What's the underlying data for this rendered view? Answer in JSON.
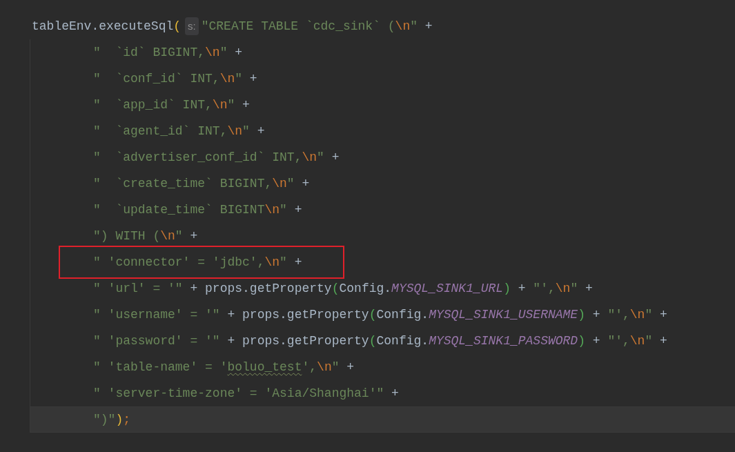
{
  "editor": {
    "lines": [
      {
        "kind": "statement",
        "current": false,
        "boxed": false,
        "tokens": [
          {
            "kind": "plain",
            "text": "tableEnv.executeSql"
          },
          {
            "kind": "bracket",
            "text": "("
          },
          {
            "kind": "hint",
            "text": "s:"
          },
          {
            "kind": "string",
            "text": "\"CREATE TABLE `cdc_sink` ("
          },
          {
            "kind": "escape",
            "text": "\\n"
          },
          {
            "kind": "string",
            "text": "\""
          },
          {
            "kind": "plain",
            "text": " +"
          }
        ]
      },
      {
        "kind": "continuation",
        "current": false,
        "boxed": false,
        "tokens": [
          {
            "kind": "string",
            "text": "\"  `id` BIGINT,"
          },
          {
            "kind": "escape",
            "text": "\\n"
          },
          {
            "kind": "string",
            "text": "\""
          },
          {
            "kind": "plain",
            "text": " +"
          }
        ]
      },
      {
        "kind": "continuation",
        "current": false,
        "boxed": false,
        "tokens": [
          {
            "kind": "string",
            "text": "\"  `conf_id` INT,"
          },
          {
            "kind": "escape",
            "text": "\\n"
          },
          {
            "kind": "string",
            "text": "\""
          },
          {
            "kind": "plain",
            "text": " +"
          }
        ]
      },
      {
        "kind": "continuation",
        "current": false,
        "boxed": false,
        "tokens": [
          {
            "kind": "string",
            "text": "\"  `app_id` INT,"
          },
          {
            "kind": "escape",
            "text": "\\n"
          },
          {
            "kind": "string",
            "text": "\""
          },
          {
            "kind": "plain",
            "text": " +"
          }
        ]
      },
      {
        "kind": "continuation",
        "current": false,
        "boxed": false,
        "tokens": [
          {
            "kind": "string",
            "text": "\"  `agent_id` INT,"
          },
          {
            "kind": "escape",
            "text": "\\n"
          },
          {
            "kind": "string",
            "text": "\""
          },
          {
            "kind": "plain",
            "text": " +"
          }
        ]
      },
      {
        "kind": "continuation",
        "current": false,
        "boxed": false,
        "tokens": [
          {
            "kind": "string",
            "text": "\"  `advertiser_conf_id` INT,"
          },
          {
            "kind": "escape",
            "text": "\\n"
          },
          {
            "kind": "string",
            "text": "\""
          },
          {
            "kind": "plain",
            "text": " +"
          }
        ]
      },
      {
        "kind": "continuation",
        "current": false,
        "boxed": false,
        "tokens": [
          {
            "kind": "string",
            "text": "\"  `create_time` BIGINT,"
          },
          {
            "kind": "escape",
            "text": "\\n"
          },
          {
            "kind": "string",
            "text": "\""
          },
          {
            "kind": "plain",
            "text": " +"
          }
        ]
      },
      {
        "kind": "continuation",
        "current": false,
        "boxed": false,
        "tokens": [
          {
            "kind": "string",
            "text": "\"  `update_time` BIGINT"
          },
          {
            "kind": "escape",
            "text": "\\n"
          },
          {
            "kind": "string",
            "text": "\""
          },
          {
            "kind": "plain",
            "text": " +"
          }
        ]
      },
      {
        "kind": "continuation",
        "current": false,
        "boxed": false,
        "tokens": [
          {
            "kind": "string",
            "text": "\") WITH ("
          },
          {
            "kind": "escape",
            "text": "\\n"
          },
          {
            "kind": "string",
            "text": "\""
          },
          {
            "kind": "plain",
            "text": " +"
          }
        ]
      },
      {
        "kind": "continuation",
        "current": false,
        "boxed": true,
        "tokens": [
          {
            "kind": "string",
            "text": "\" 'connector' = 'jdbc',"
          },
          {
            "kind": "escape",
            "text": "\\n"
          },
          {
            "kind": "string",
            "text": "\""
          },
          {
            "kind": "plain",
            "text": " +"
          }
        ]
      },
      {
        "kind": "continuation",
        "current": false,
        "boxed": false,
        "tokens": [
          {
            "kind": "string",
            "text": "\" 'url' = '\""
          },
          {
            "kind": "plain",
            "text": " + props.getProperty"
          },
          {
            "kind": "bracket2",
            "text": "("
          },
          {
            "kind": "plain",
            "text": "Config."
          },
          {
            "kind": "constant",
            "text": "MYSQL_SINK1_URL"
          },
          {
            "kind": "bracket2",
            "text": ")"
          },
          {
            "kind": "plain",
            "text": " + "
          },
          {
            "kind": "string",
            "text": "\"',"
          },
          {
            "kind": "escape",
            "text": "\\n"
          },
          {
            "kind": "string",
            "text": "\""
          },
          {
            "kind": "plain",
            "text": " +"
          }
        ]
      },
      {
        "kind": "continuation",
        "current": false,
        "boxed": false,
        "tokens": [
          {
            "kind": "string",
            "text": "\" 'username' = '\""
          },
          {
            "kind": "plain",
            "text": " + props.getProperty"
          },
          {
            "kind": "bracket2",
            "text": "("
          },
          {
            "kind": "plain",
            "text": "Config."
          },
          {
            "kind": "constant",
            "text": "MYSQL_SINK1_USERNAME"
          },
          {
            "kind": "bracket2",
            "text": ")"
          },
          {
            "kind": "plain",
            "text": " + "
          },
          {
            "kind": "string",
            "text": "\"',"
          },
          {
            "kind": "escape",
            "text": "\\n"
          },
          {
            "kind": "string",
            "text": "\""
          },
          {
            "kind": "plain",
            "text": " +"
          }
        ]
      },
      {
        "kind": "continuation",
        "current": false,
        "boxed": false,
        "tokens": [
          {
            "kind": "string",
            "text": "\" 'password' = '\""
          },
          {
            "kind": "plain",
            "text": " + props.getProperty"
          },
          {
            "kind": "bracket2",
            "text": "("
          },
          {
            "kind": "plain",
            "text": "Config."
          },
          {
            "kind": "constant",
            "text": "MYSQL_SINK1_PASSWORD"
          },
          {
            "kind": "bracket2",
            "text": ")"
          },
          {
            "kind": "plain",
            "text": " + "
          },
          {
            "kind": "string",
            "text": "\"',"
          },
          {
            "kind": "escape",
            "text": "\\n"
          },
          {
            "kind": "string",
            "text": "\""
          },
          {
            "kind": "plain",
            "text": " +"
          }
        ]
      },
      {
        "kind": "continuation",
        "current": false,
        "boxed": false,
        "tokens": [
          {
            "kind": "string",
            "text": "\" 'table-name' = '"
          },
          {
            "kind": "typo",
            "text": "boluo_test"
          },
          {
            "kind": "string",
            "text": "',"
          },
          {
            "kind": "escape",
            "text": "\\n"
          },
          {
            "kind": "string",
            "text": "\""
          },
          {
            "kind": "plain",
            "text": " +"
          }
        ]
      },
      {
        "kind": "continuation",
        "current": false,
        "boxed": false,
        "tokens": [
          {
            "kind": "string",
            "text": "\" 'server-time-zone' = 'Asia/Shanghai'\""
          },
          {
            "kind": "plain",
            "text": " +"
          }
        ]
      },
      {
        "kind": "continuation",
        "current": true,
        "boxed": false,
        "tokens": [
          {
            "kind": "string",
            "text": "\")\""
          },
          {
            "kind": "bracket",
            "text": ")"
          },
          {
            "kind": "keyword",
            "text": ";"
          }
        ]
      }
    ]
  }
}
